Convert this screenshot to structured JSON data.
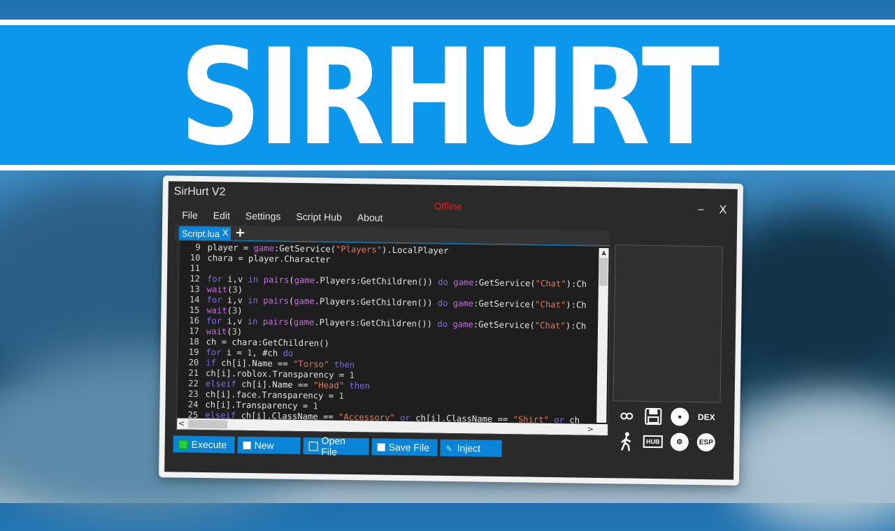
{
  "banner": {
    "title": "SIRHURT"
  },
  "window": {
    "title": "SirHurt V2",
    "status": "Offline",
    "minimize_symbol": "_",
    "close_symbol": "X"
  },
  "menu": [
    "File",
    "Edit",
    "Settings",
    "Script Hub",
    "About"
  ],
  "tab": {
    "label": "Script.lua",
    "close_symbol": "X",
    "add_symbol": "+"
  },
  "editor": {
    "lines": [
      {
        "n": "9",
        "code": "player = game:GetService(\"Players\").LocalPlayer"
      },
      {
        "n": "10",
        "code": "chara = player.Character"
      },
      {
        "n": "11",
        "code": ""
      },
      {
        "n": "12",
        "code": "for i,v in pairs(game.Players:GetChildren()) do game:GetService(\"Chat\"):Ch"
      },
      {
        "n": "13",
        "code": "wait(3)"
      },
      {
        "n": "14",
        "code": "for i,v in pairs(game.Players:GetChildren()) do game:GetService(\"Chat\"):Ch"
      },
      {
        "n": "15",
        "code": "wait(3)"
      },
      {
        "n": "16",
        "code": "for i,v in pairs(game.Players:GetChildren()) do game:GetService(\"Chat\"):Ch"
      },
      {
        "n": "17",
        "code": "wait(3)"
      },
      {
        "n": "18",
        "code": "ch = chara:GetChildren()"
      },
      {
        "n": "19",
        "code": "for i = 1, #ch do"
      },
      {
        "n": "20",
        "code": "if ch[i].Name == \"Torso\" then"
      },
      {
        "n": "21",
        "code": "ch[i].roblox.Transparency = 1"
      },
      {
        "n": "22",
        "code": "elseif ch[i].Name == \"Head\" then"
      },
      {
        "n": "23",
        "code": "ch[i].face.Transparency = 1"
      },
      {
        "n": "24",
        "code": "ch[i].Transparency = 1"
      },
      {
        "n": "25",
        "code": "elseif ch[i].ClassName == \"Accessory\" or ch[i].ClassName == \"Shirt\" or ch"
      }
    ]
  },
  "buttons": {
    "execute": "Execute",
    "new": "New",
    "open_file": "Open File",
    "save_file": "Save File",
    "inject": "Inject"
  },
  "side_icons": {
    "dex": "DEX",
    "hub": "HUB",
    "esp": "ESP"
  },
  "colors": {
    "banner": "#0a97ec",
    "accent": "#0a84d6",
    "status": "#e02020",
    "window_bg": "#2a2a2a"
  }
}
